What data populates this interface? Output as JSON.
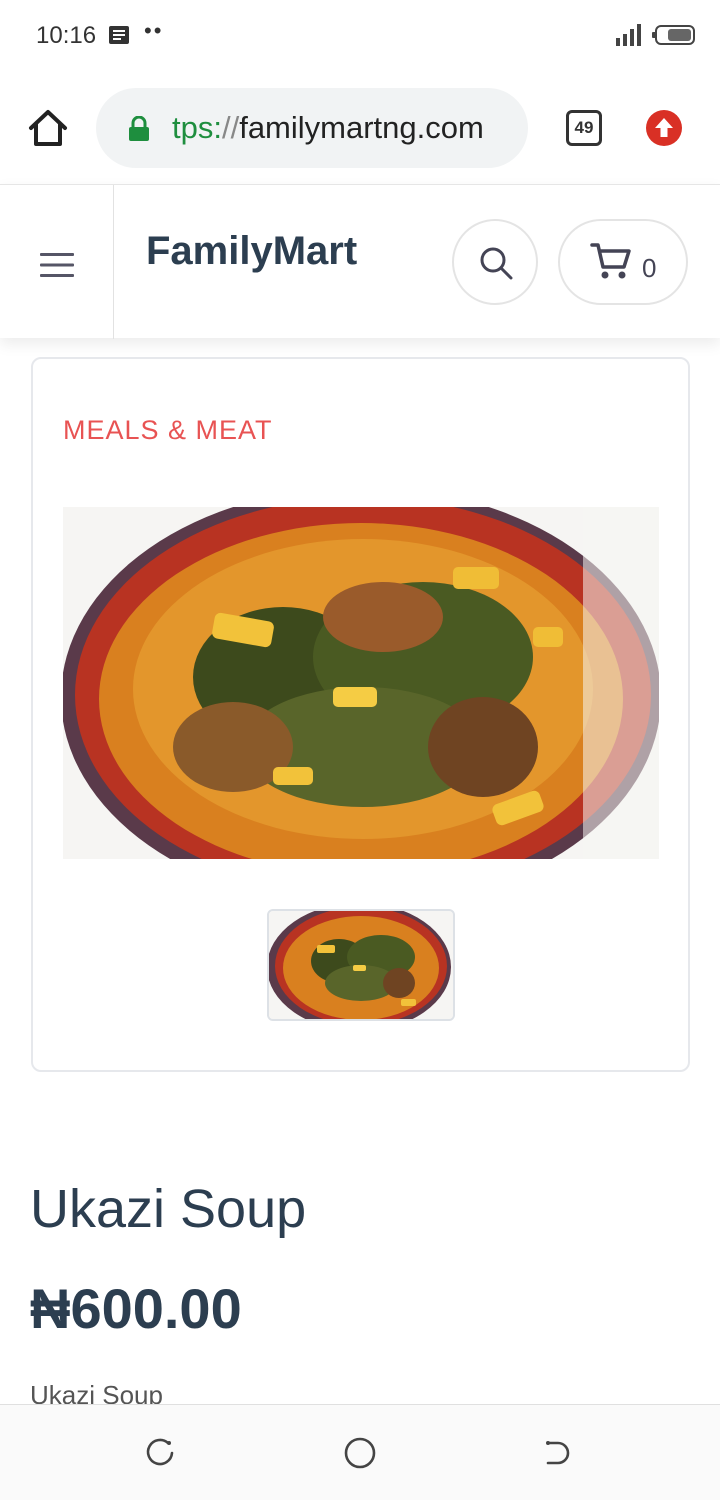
{
  "status_bar": {
    "time": "10:16",
    "dots": "••",
    "icons": [
      "message-icon",
      "signal-icon",
      "battery-icon"
    ]
  },
  "browser": {
    "url_scheme": "tps:",
    "url_sep": "//",
    "url_host": "familymartng.com",
    "tab_count": "49",
    "icons": [
      "home-icon",
      "lock-icon",
      "upload-icon"
    ]
  },
  "site": {
    "brand": "FamilyMart",
    "cart_count": "0",
    "icons": [
      "hamburger-menu-icon",
      "search-icon",
      "cart-icon"
    ]
  },
  "product": {
    "category": "MEALS & MEAT",
    "title": "Ukazi Soup",
    "price": "₦600.00",
    "description": "Ukazi Soup"
  },
  "colors": {
    "accent_category": "#e85353",
    "text_primary": "#2c3e50",
    "url_secure": "#1e8e3e",
    "upload_button": "#d93025"
  },
  "nav_bar": {
    "icons": [
      "recent-apps-icon",
      "home-circle-icon",
      "back-icon"
    ]
  }
}
